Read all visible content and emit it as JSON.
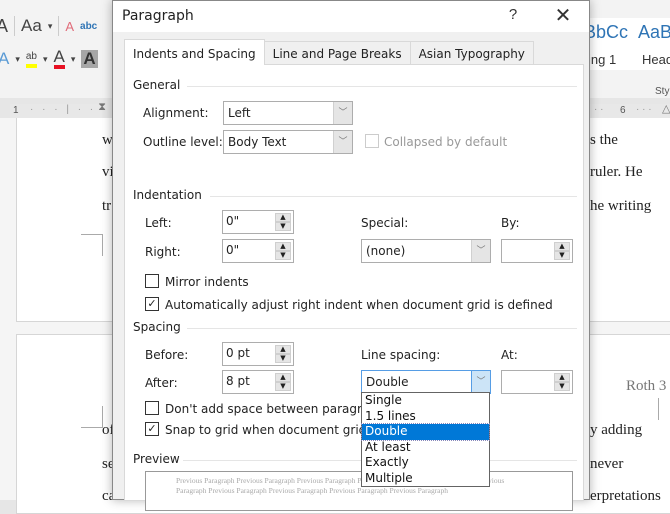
{
  "ribbon": {
    "font_grow_label": "A",
    "change_case_label": "Aa",
    "clear_formatting_label": "A",
    "text_effects_label": "abc",
    "highlight_label": "ab",
    "font_color_label": "A",
    "character_shading_label": "A",
    "highlight_color": "#ffff00",
    "font_color": "#e81123",
    "styles": [
      {
        "sample": "BbCc",
        "name": "ing 1"
      },
      {
        "sample": "AaBb",
        "name": "Head"
      }
    ],
    "styles_group_label": "Sty"
  },
  "ruler": {
    "left_marker": "1",
    "right_marker": "6"
  },
  "document": {
    "page1_right_lines": [
      "s the",
      "ruler. He",
      "he writing"
    ],
    "page1_left_lines": [
      "w",
      "vi",
      "tr"
    ],
    "page2_header": "Roth 3",
    "page2_right_lines": [
      "y adding",
      "never",
      "erpretations"
    ],
    "page2_left_lines": [
      "of",
      "se",
      "ca"
    ]
  },
  "dialog": {
    "title": "Paragraph",
    "help_label": "?",
    "close_label": "✕",
    "tabs": [
      {
        "label": "Indents and Spacing",
        "active": true
      },
      {
        "label": "Line and Page Breaks",
        "active": false
      },
      {
        "label": "Asian Typography",
        "active": false
      }
    ],
    "general": {
      "title": "General",
      "alignment_label": "Alignment:",
      "alignment_value": "Left",
      "outline_label": "Outline level:",
      "outline_value": "Body Text",
      "collapsed_label": "Collapsed by default",
      "collapsed_checked": false
    },
    "indentation": {
      "title": "Indentation",
      "left_label": "Left:",
      "left_value": "0\"",
      "right_label": "Right:",
      "right_value": "0\"",
      "special_label": "Special:",
      "special_value": "(none)",
      "by_label": "By:",
      "by_value": "",
      "mirror_label": "Mirror indents",
      "mirror_checked": false,
      "auto_adjust_label": "Automatically adjust right indent when document grid is defined",
      "auto_adjust_checked": true
    },
    "spacing": {
      "title": "Spacing",
      "before_label": "Before:",
      "before_value": "0 pt",
      "after_label": "After:",
      "after_value": "8 pt",
      "line_spacing_label": "Line spacing:",
      "line_spacing_value": "Double",
      "at_label": "At:",
      "at_value": "",
      "dont_add_label": "Don't add space between paragraphs o",
      "dont_add_checked": false,
      "snap_label": "Snap to grid when document grid is de",
      "snap_checked": true,
      "line_spacing_options": [
        "Single",
        "1.5 lines",
        "Double",
        "At least",
        "Exactly",
        "Multiple"
      ],
      "line_spacing_selected": "Double"
    },
    "preview": {
      "title": "Preview",
      "line1": "Previous Paragraph Previous Paragraph Previous Paragraph Previous Paragraph Previous Paragraph Previous",
      "line2": "Paragraph Previous Paragraph Previous Paragraph Previous Paragraph Previous Paragraph"
    }
  }
}
